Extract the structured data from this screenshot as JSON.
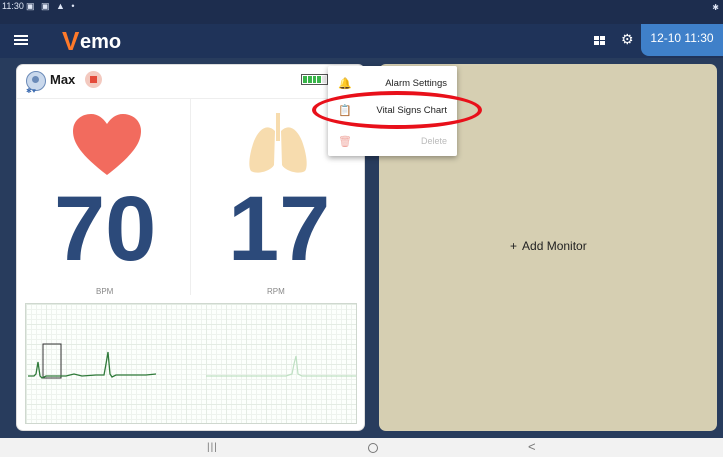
{
  "status_bar": {
    "time": "11:30",
    "icons": "▣ ▣ ▲ •",
    "bluetooth": "✱"
  },
  "app_bar": {
    "logo_v": "V",
    "logo_rest": "emo",
    "datetime": "12-10 11:30"
  },
  "monitor": {
    "pet_name": "Max",
    "battery_level": 0.8,
    "heart_rate": {
      "value": "70",
      "unit": "BPM"
    },
    "resp_rate": {
      "value": "17",
      "unit": "RPM"
    }
  },
  "add_monitor": {
    "plus": "+",
    "label": "Add Monitor"
  },
  "context_menu": {
    "items": [
      {
        "label": "Alarm Settings",
        "icon": "bell-icon"
      },
      {
        "label": "Vital Signs Chart",
        "icon": "clipboard-heart-icon"
      },
      {
        "label": "Delete",
        "icon": "trash-icon",
        "disabled": true
      }
    ]
  },
  "nav": {
    "recents": "|||",
    "back": "<"
  },
  "colors": {
    "accent_blue": "#3f80c9",
    "heart": "#f26b5e",
    "lungs": "#f7dcae",
    "annotation": "#e8101a",
    "panel": "#d6cfb2"
  }
}
